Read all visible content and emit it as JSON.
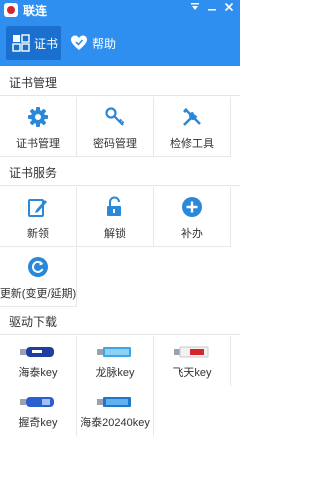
{
  "window": {
    "title": "联连"
  },
  "nav": {
    "cert_label": "证书",
    "help_label": "帮助"
  },
  "cert_manage": {
    "title": "证书管理",
    "items": [
      {
        "label": "证书管理",
        "icon": "gear-icon"
      },
      {
        "label": "密码管理",
        "icon": "key-icon"
      },
      {
        "label": "检修工具",
        "icon": "tools-icon"
      }
    ]
  },
  "cert_service": {
    "title": "证书服务",
    "items": [
      {
        "label": "新领",
        "icon": "edit-icon"
      },
      {
        "label": "解锁",
        "icon": "unlock-icon"
      },
      {
        "label": "补办",
        "icon": "plus-circle-icon"
      },
      {
        "label": "更新(变更/延期)",
        "icon": "refresh-icon"
      }
    ]
  },
  "drivers": {
    "title": "驱动下载",
    "items": [
      {
        "label": "海泰key",
        "icon": "usb-key-icon"
      },
      {
        "label": "龙脉key",
        "icon": "usb-key-icon"
      },
      {
        "label": "飞天key",
        "icon": "usb-key-icon"
      },
      {
        "label": "握奇key",
        "icon": "usb-key-icon"
      },
      {
        "label": "海泰20240key",
        "icon": "usb-key-icon"
      }
    ]
  },
  "colors": {
    "brand_blue": "#2f8ff0",
    "active_nav": "#1a6fcf",
    "icon_blue": "#2a88d8"
  }
}
